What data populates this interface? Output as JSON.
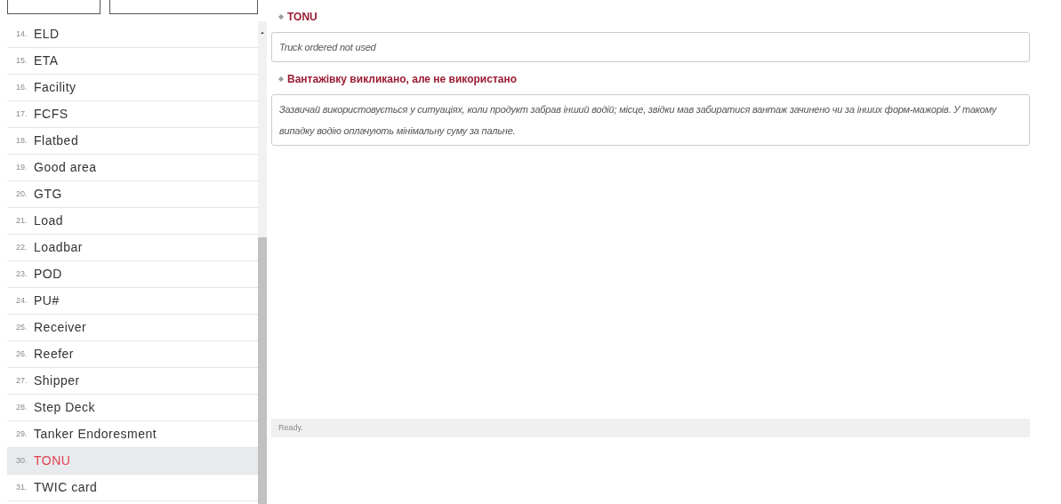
{
  "glossary": {
    "items": [
      {
        "number": "14.",
        "term": "ELD",
        "selected": false
      },
      {
        "number": "15.",
        "term": "ETA",
        "selected": false
      },
      {
        "number": "16.",
        "term": "Facility",
        "selected": false
      },
      {
        "number": "17.",
        "term": "FCFS",
        "selected": false
      },
      {
        "number": "18.",
        "term": "Flatbed",
        "selected": false
      },
      {
        "number": "19.",
        "term": "Good area",
        "selected": false
      },
      {
        "number": "20.",
        "term": "GTG",
        "selected": false
      },
      {
        "number": "21.",
        "term": "Load",
        "selected": false
      },
      {
        "number": "22.",
        "term": "Loadbar",
        "selected": false
      },
      {
        "number": "23.",
        "term": "POD",
        "selected": false
      },
      {
        "number": "24.",
        "term": "PU#",
        "selected": false
      },
      {
        "number": "25.",
        "term": "Receiver",
        "selected": false
      },
      {
        "number": "26.",
        "term": "Reefer",
        "selected": false
      },
      {
        "number": "27.",
        "term": "Shipper",
        "selected": false
      },
      {
        "number": "28.",
        "term": "Step Deck",
        "selected": false
      },
      {
        "number": "29.",
        "term": "Tanker Endoresment",
        "selected": false
      },
      {
        "number": "30.",
        "term": "TONU",
        "selected": true
      },
      {
        "number": "31.",
        "term": "TWIC card",
        "selected": false
      }
    ]
  },
  "detail": {
    "sections": [
      {
        "heading": "TONU",
        "text": "Truck ordered not used"
      },
      {
        "heading": "Вантажівку викликано, але не використано",
        "text": "Зазвичай використовується у ситуаціях, коли продукт забрав інший водій; місце, звідки мав забиратися вантаж зачинено чи за інших форм-мажорів. У такому випадку водію оплачують мінімальну суму за пальне."
      }
    ]
  },
  "status_bar": "Ready."
}
